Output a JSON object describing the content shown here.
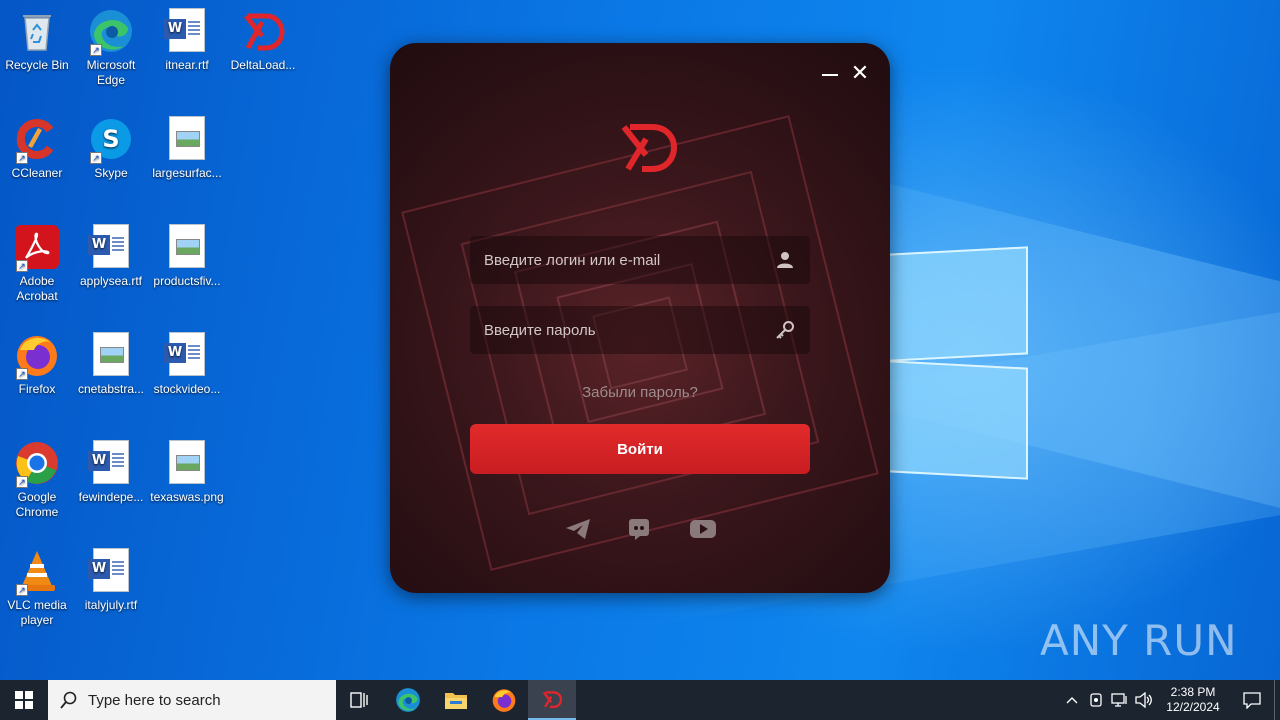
{
  "desktop": {
    "icons": [
      {
        "label": "Recycle Bin"
      },
      {
        "label": "Microsoft Edge"
      },
      {
        "label": "itnear.rtf"
      },
      {
        "label": "DeltaLoad..."
      },
      {
        "label": "CCleaner"
      },
      {
        "label": "Skype"
      },
      {
        "label": "largesurfac..."
      },
      {
        "label": "Adobe Acrobat"
      },
      {
        "label": "applysea.rtf"
      },
      {
        "label": "productsfiv..."
      },
      {
        "label": "Firefox"
      },
      {
        "label": "cnetabstra..."
      },
      {
        "label": "stockvideo..."
      },
      {
        "label": "Google Chrome"
      },
      {
        "label": "fewindepe..."
      },
      {
        "label": "texaswas.png"
      },
      {
        "label": "VLC media player"
      },
      {
        "label": "italyjuly.rtf"
      }
    ],
    "watermark": "ANY RUN"
  },
  "login_window": {
    "login_placeholder": "Введите логин или e-mail",
    "password_placeholder": "Введите пароль",
    "forgot_label": "Забыли пароль?",
    "submit_label": "Войти",
    "accent_color": "#e0262a",
    "social_icons": [
      "telegram-icon",
      "discord-icon",
      "youtube-icon"
    ]
  },
  "taskbar": {
    "search_placeholder": "Type here to search",
    "pinned_icons": [
      "task-view-icon",
      "edge-icon",
      "file-explorer-icon",
      "firefox-icon",
      "deltaloader-icon"
    ],
    "active_app": "deltaloader-icon",
    "time": "2:38 PM",
    "date": "12/2/2024"
  }
}
